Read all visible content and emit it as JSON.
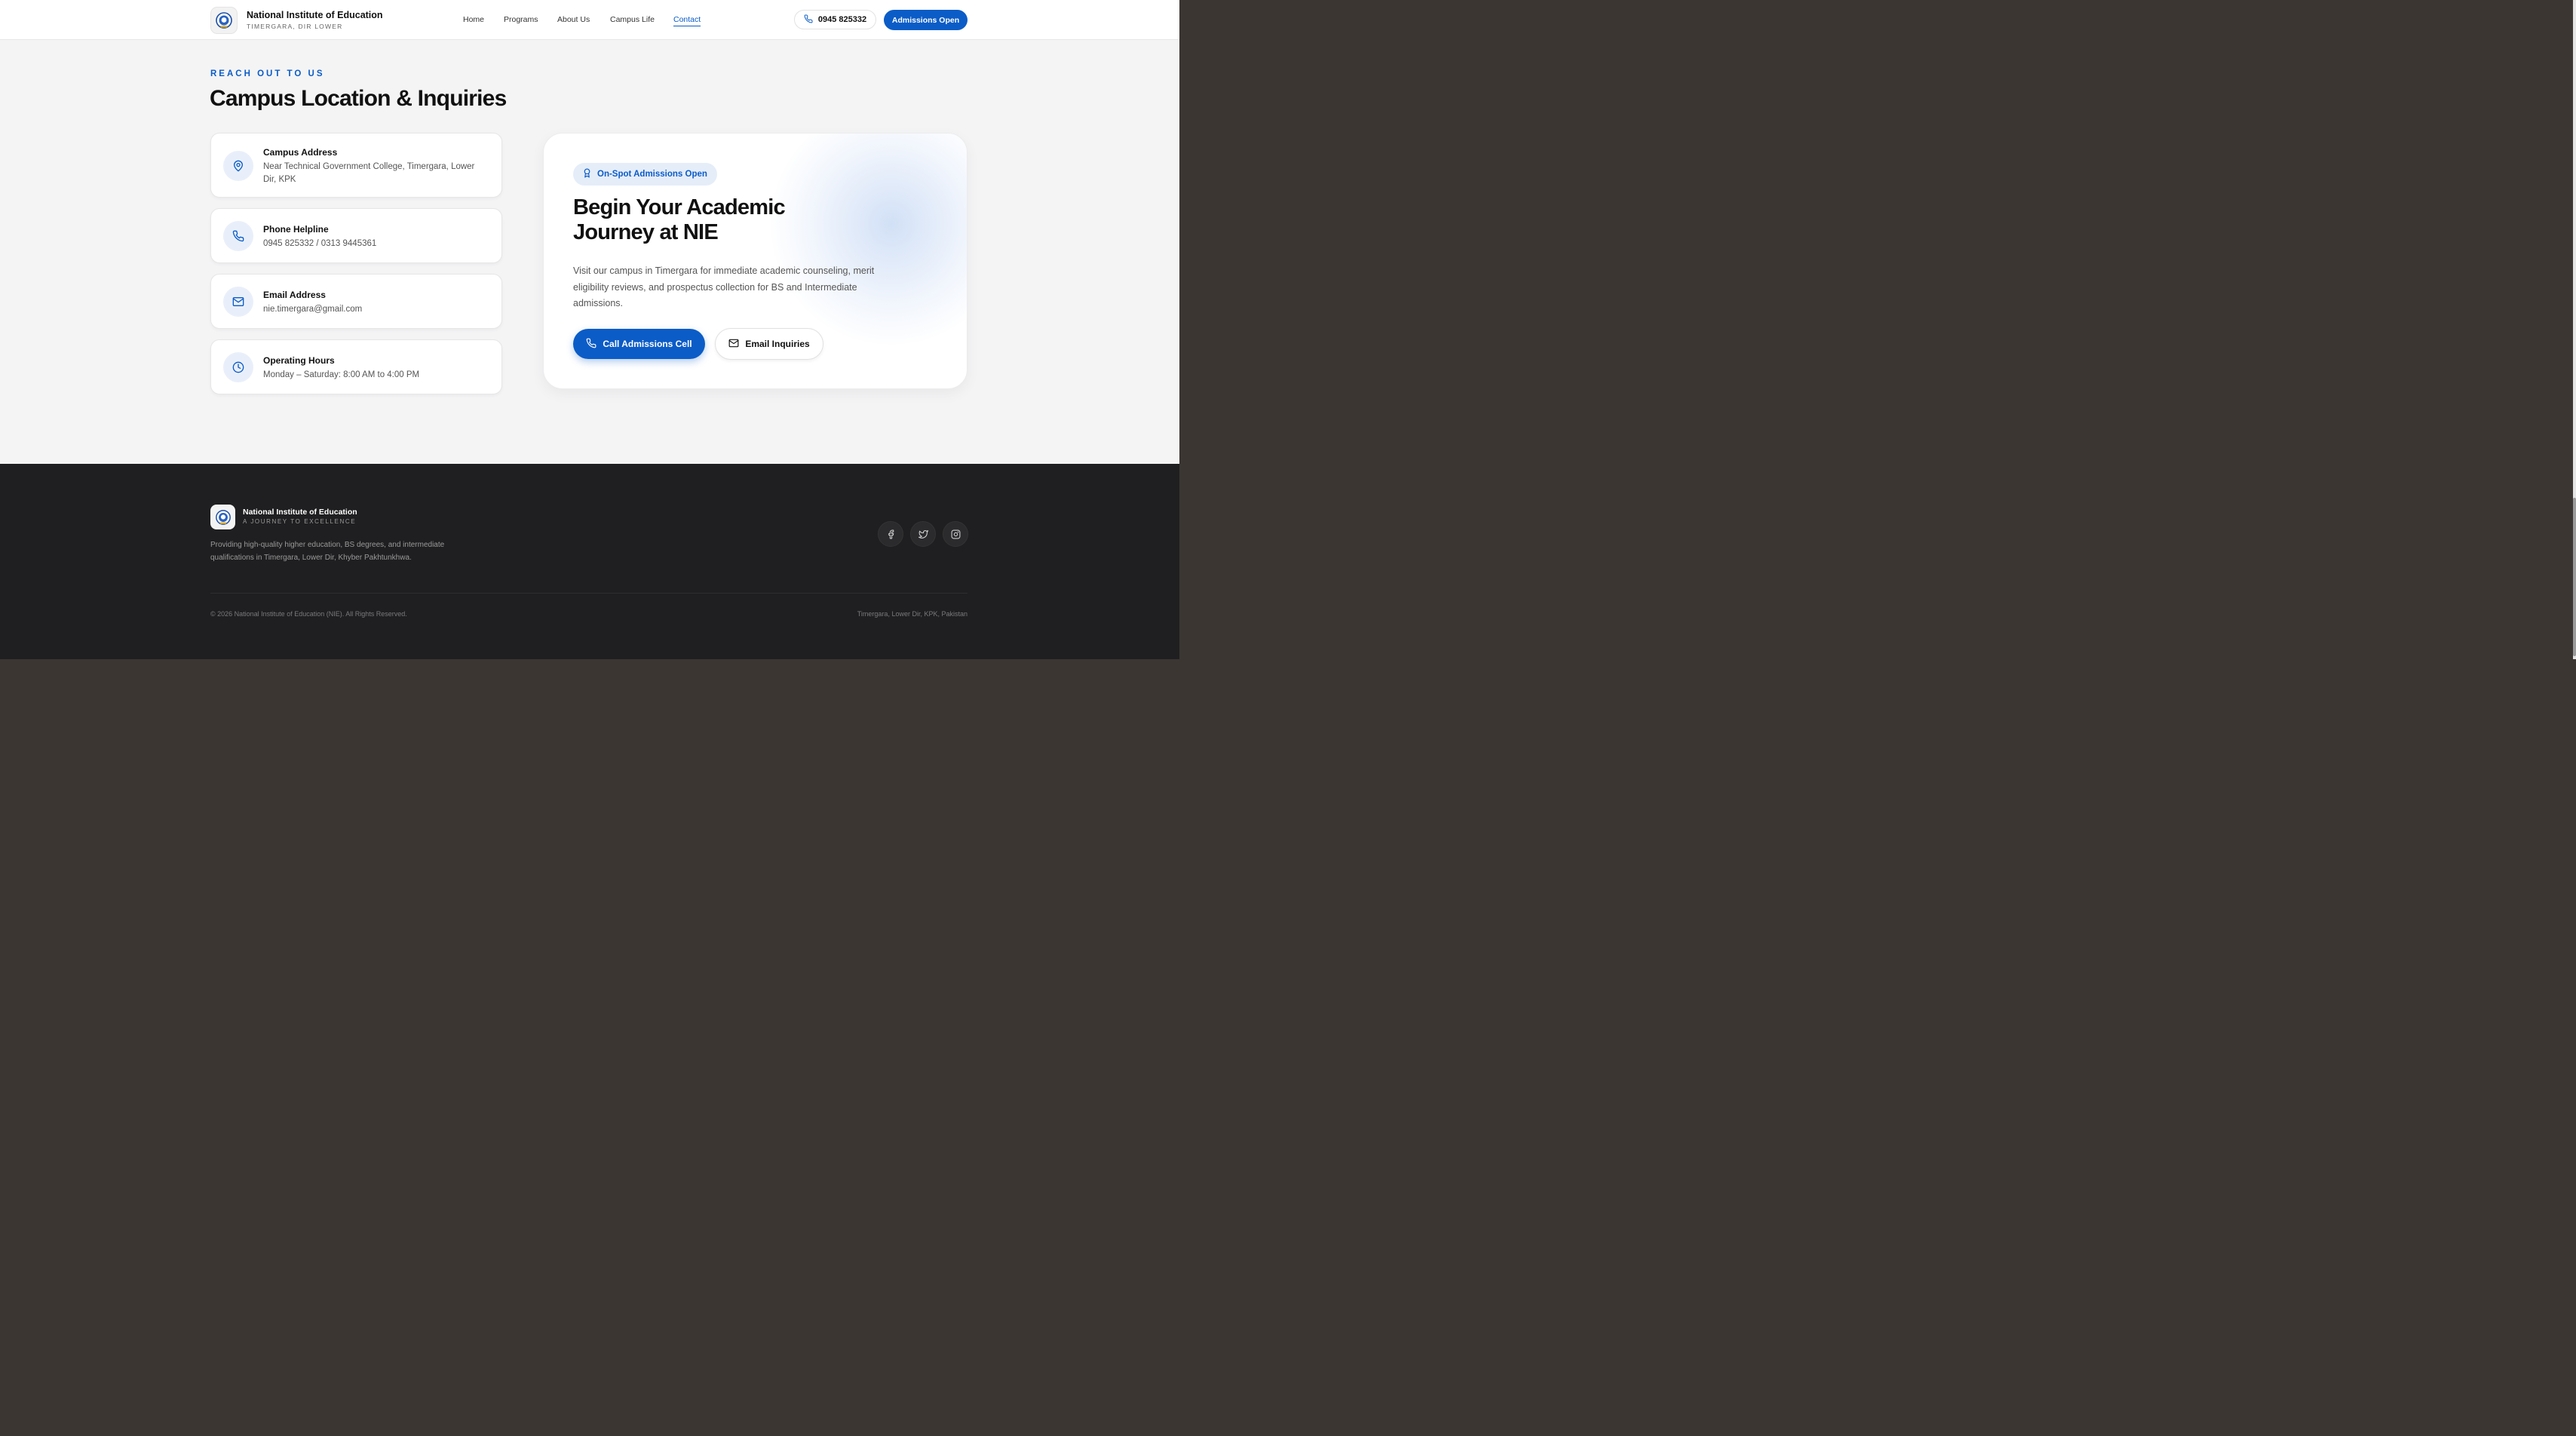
{
  "header": {
    "brand_name": "National Institute of Education",
    "brand_sub": "TIMERGARA, DIR LOWER",
    "nav": [
      {
        "label": "Home"
      },
      {
        "label": "Programs"
      },
      {
        "label": "About Us"
      },
      {
        "label": "Campus Life"
      },
      {
        "label": "Contact",
        "active": true
      }
    ],
    "phone": "0945 825332",
    "admissions_button": "Admissions Open"
  },
  "contact": {
    "eyebrow": "REACH OUT TO US",
    "title": "Campus Location & Inquiries",
    "cards": [
      {
        "icon": "map-pin-icon",
        "title": "Campus Address",
        "text": "Near Technical Government College, Timergara, Lower Dir, KPK"
      },
      {
        "icon": "phone-icon",
        "title": "Phone Helpline",
        "text": "0945 825332 / 0313 9445361"
      },
      {
        "icon": "mail-icon",
        "title": "Email Address",
        "text": "nie.timergara@gmail.com"
      },
      {
        "icon": "clock-icon",
        "title": "Operating Hours",
        "text": "Monday – Saturday: 8:00 AM to 4:00 PM"
      }
    ]
  },
  "cta": {
    "badge": "On-Spot Admissions Open",
    "title": "Begin Your Academic Journey at NIE",
    "description": "Visit our campus in Timergara for immediate academic counseling, merit eligibility reviews, and prospectus collection for BS and Intermediate admissions.",
    "call_button": "Call Admissions Cell",
    "email_button": "Email Inquiries"
  },
  "footer": {
    "brand_name": "National Institute of Education",
    "tagline": "A JOURNEY TO EXCELLENCE",
    "description": "Providing high-quality higher education, BS degrees, and intermediate qualifications in Timergara, Lower Dir, Khyber Pakhtunkhwa.",
    "social": [
      "facebook-icon",
      "twitter-icon",
      "instagram-icon"
    ],
    "copyright": "© 2026 National Institute of Education (NIE). All Rights Reserved.",
    "location": "Timergara, Lower Dir, KPK, Pakistan"
  },
  "colors": {
    "accent": "#0b5cc7",
    "page_bg": "#f4f4f5",
    "footer_bg": "#1f1f21",
    "icon_bg": "#e9effa"
  }
}
